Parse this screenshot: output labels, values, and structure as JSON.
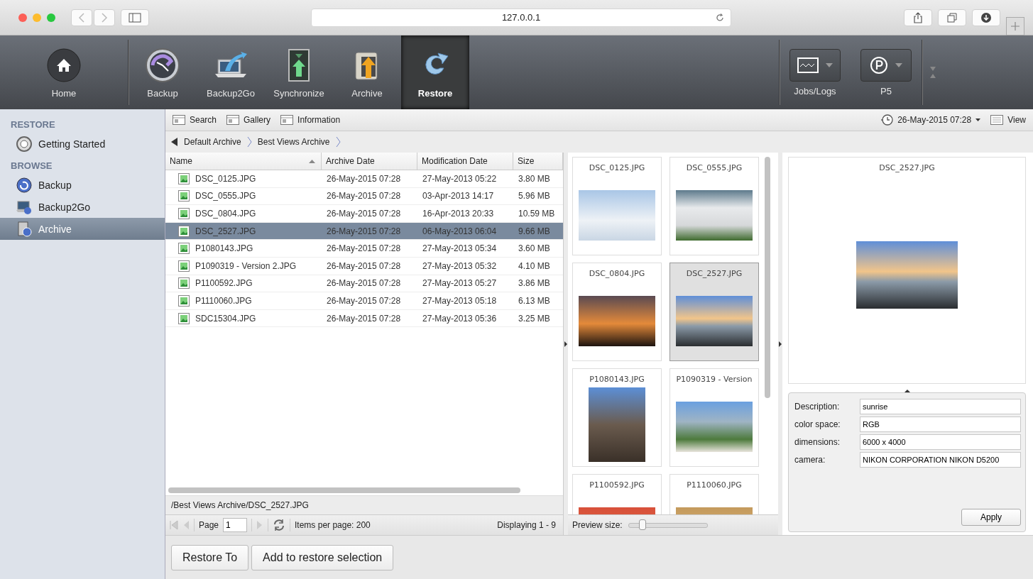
{
  "browser": {
    "url": "127.0.0.1"
  },
  "toolbar": {
    "items": [
      {
        "label": "Home",
        "kind": "home",
        "selected": false
      },
      {
        "label": "Backup",
        "kind": "clock",
        "selected": false
      },
      {
        "label": "Backup2Go",
        "kind": "laptop",
        "selected": false
      },
      {
        "label": "Synchronize",
        "kind": "sync",
        "selected": false
      },
      {
        "label": "Archive",
        "kind": "safe",
        "selected": false
      },
      {
        "label": "Restore",
        "kind": "restore",
        "selected": true
      }
    ],
    "right": [
      {
        "label": "Jobs/Logs",
        "kind": "monitor"
      },
      {
        "label": "P5",
        "kind": "p5"
      }
    ]
  },
  "sidebar": {
    "sections": [
      {
        "heading": "RESTORE",
        "items": [
          {
            "label": "Getting Started",
            "kind": "help",
            "selected": false
          }
        ]
      },
      {
        "heading": "BROWSE",
        "items": [
          {
            "label": "Backup",
            "kind": "backup",
            "selected": false
          },
          {
            "label": "Backup2Go",
            "kind": "laptop",
            "selected": false
          },
          {
            "label": "Archive",
            "kind": "archive",
            "selected": true
          }
        ]
      }
    ]
  },
  "view_bar": {
    "tabs": [
      "Search",
      "Gallery",
      "Information"
    ],
    "date": "26-May-2015 07:28",
    "view": "View"
  },
  "breadcrumb": [
    "Default Archive",
    "Best Views Archive"
  ],
  "table": {
    "columns": [
      {
        "label": "Name",
        "sorted": true
      },
      {
        "label": "Archive Date",
        "sorted": false
      },
      {
        "label": "Modification Date",
        "sorted": false
      },
      {
        "label": "Size",
        "sorted": false
      }
    ],
    "rows": [
      {
        "cells": [
          "DSC_0125.JPG",
          "26-May-2015 07:28",
          "27-May-2013 05:22",
          "3.80 MB"
        ],
        "selected": false
      },
      {
        "cells": [
          "DSC_0555.JPG",
          "26-May-2015 07:28",
          "03-Apr-2013 14:17",
          "5.96 MB"
        ],
        "selected": false
      },
      {
        "cells": [
          "DSC_0804.JPG",
          "26-May-2015 07:28",
          "16-Apr-2013 20:33",
          "10.59 MB"
        ],
        "selected": false
      },
      {
        "cells": [
          "DSC_2527.JPG",
          "26-May-2015 07:28",
          "06-May-2013 06:04",
          "9.66 MB"
        ],
        "selected": true
      },
      {
        "cells": [
          "P1080143.JPG",
          "26-May-2015 07:28",
          "27-May-2013 05:34",
          "3.60 MB"
        ],
        "selected": false
      },
      {
        "cells": [
          "P1090319 - Version 2.JPG",
          "26-May-2015 07:28",
          "27-May-2013 05:32",
          "4.10 MB"
        ],
        "selected": false
      },
      {
        "cells": [
          "P1100592.JPG",
          "26-May-2015 07:28",
          "27-May-2013 05:27",
          "3.86 MB"
        ],
        "selected": false
      },
      {
        "cells": [
          "P1110060.JPG",
          "26-May-2015 07:28",
          "27-May-2013 05:18",
          "6.13 MB"
        ],
        "selected": false
      },
      {
        "cells": [
          "SDC15304.JPG",
          "26-May-2015 07:28",
          "27-May-2013 05:36",
          "3.25 MB"
        ],
        "selected": false
      }
    ]
  },
  "path": "/Best Views Archive/DSC_2527.JPG",
  "pager": {
    "page_label": "Page",
    "page": "1",
    "items_per_page": "Items per page: 200",
    "displaying": "Displaying 1 - 9"
  },
  "gallery": {
    "tiles": [
      {
        "name": "DSC_0125.JPG",
        "selected": false
      },
      {
        "name": "DSC_0555.JPG",
        "selected": false
      },
      {
        "name": "DSC_0804.JPG",
        "selected": false
      },
      {
        "name": "DSC_2527.JPG",
        "selected": true
      },
      {
        "name": "P1080143.JPG",
        "selected": false
      },
      {
        "name": "P1090319 - Version",
        "selected": false
      },
      {
        "name": "P1100592.JPG",
        "selected": false
      },
      {
        "name": "P1110060.JPG",
        "selected": false
      }
    ],
    "preview_size": {
      "label": "Preview size:",
      "level": 0.18
    }
  },
  "preview": {
    "name": "DSC_2527.JPG"
  },
  "properties": [
    {
      "label": "Description:",
      "value": "sunrise"
    },
    {
      "label": "color space:",
      "value": "RGB"
    },
    {
      "label": "dimensions:",
      "value": "6000 x 4000"
    },
    {
      "label": "camera:",
      "value": "NIKON CORPORATION NIKON D5200"
    }
  ],
  "apply": "Apply",
  "buttons": [
    "Restore To",
    "Add to restore selection"
  ]
}
